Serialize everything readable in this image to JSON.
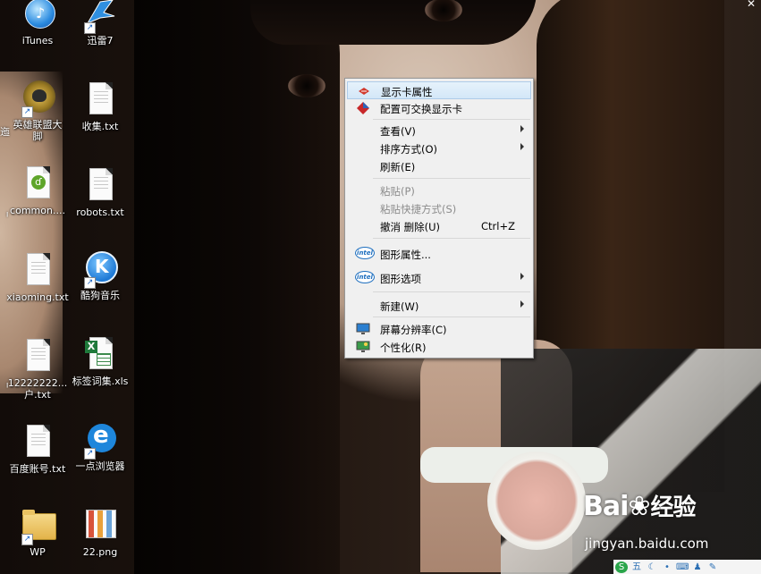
{
  "desktop": {
    "icons": [
      {
        "label": "iTunes",
        "icon": "itunes-icon"
      },
      {
        "label": "迅雷7",
        "icon": "xunlei-bird-icon"
      },
      {
        "label": "英雄联盟大\n脚",
        "icon": "lol-box-icon"
      },
      {
        "label": "收集.txt",
        "icon": "text-file-icon"
      },
      {
        "label": "common....",
        "icon": "dreamweaver-file-icon"
      },
      {
        "label": "robots.txt",
        "icon": "text-file-icon"
      },
      {
        "label": "xiaoming.txt",
        "icon": "text-file-icon"
      },
      {
        "label": "酷狗音乐",
        "icon": "kugou-music-icon"
      },
      {
        "label": "12222222...\n户.txt",
        "icon": "text-file-icon"
      },
      {
        "label": "标签词集.xls",
        "icon": "excel-file-icon"
      },
      {
        "label": "百度账号.txt",
        "icon": "text-file-icon"
      },
      {
        "label": "一点浏览器",
        "icon": "browser-e-icon"
      },
      {
        "label": "WP",
        "icon": "folder-icon"
      },
      {
        "label": "22.png",
        "icon": "image-file-icon"
      }
    ],
    "edge_labels": [
      "迤",
      "ᅵ",
      "ᅵ"
    ]
  },
  "context_menu": {
    "items": [
      {
        "label": "显示卡属性",
        "icon": "graphics-card-icon",
        "highlighted": true
      },
      {
        "label": "配置可交换显示卡",
        "icon": "amd-diamond-icon"
      },
      {
        "label": "查看(V)",
        "submenu": true
      },
      {
        "label": "排序方式(O)",
        "submenu": true
      },
      {
        "label": "刷新(E)"
      },
      {
        "label": "粘贴(P)",
        "disabled": true
      },
      {
        "label": "粘贴快捷方式(S)",
        "disabled": true
      },
      {
        "label": "撤消 删除(U)",
        "shortcut": "Ctrl+Z"
      },
      {
        "label": "图形属性...",
        "icon": "intel-icon"
      },
      {
        "label": "图形选项",
        "icon": "intel-icon",
        "submenu": true
      },
      {
        "label": "新建(W)",
        "submenu": true
      },
      {
        "label": "屏幕分辨率(C)",
        "icon": "monitor-icon"
      },
      {
        "label": "个性化(R)",
        "icon": "personalize-icon"
      }
    ],
    "intel_text": "intel"
  },
  "watermark": {
    "brand": "Bai",
    "brand2": "经验",
    "url": "jingyan.baidu.com"
  },
  "tray": {
    "items": [
      "sogou-icon",
      "五",
      "moon-icon",
      "dot-icon",
      "keyboard-icon",
      "user-icon",
      "wrench-icon"
    ]
  },
  "colors": {
    "menu_bg": "#f0f0f0",
    "highlight": "#d3e7f8",
    "disabled_text": "#8c8c8c"
  }
}
